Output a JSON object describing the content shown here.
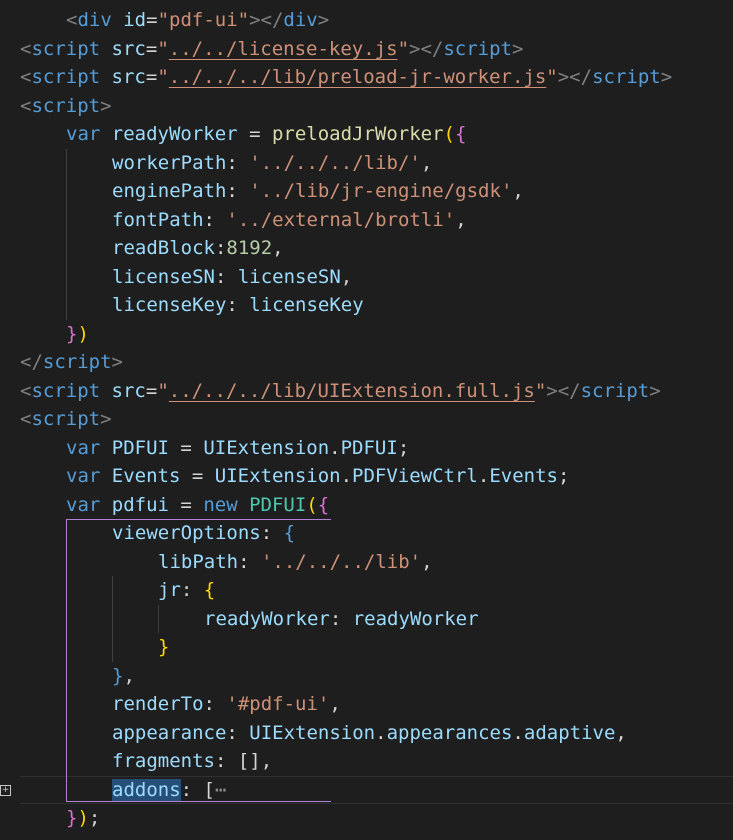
{
  "editor": {
    "lines": [
      {
        "indent": 1,
        "tokens": [
          [
            "t-tag",
            "<"
          ],
          [
            "t-name",
            "div"
          ],
          [
            "t-punc",
            " "
          ],
          [
            "t-attr",
            "id"
          ],
          [
            "t-punc",
            "="
          ],
          [
            "t-str",
            "\"pdf-ui\""
          ],
          [
            "t-tag",
            "></"
          ],
          [
            "t-name",
            "div"
          ],
          [
            "t-tag",
            ">"
          ]
        ]
      },
      {
        "indent": 0,
        "tokens": [
          [
            "t-tag",
            "<"
          ],
          [
            "t-name",
            "script"
          ],
          [
            "t-punc",
            " "
          ],
          [
            "t-attr",
            "src"
          ],
          [
            "t-punc",
            "="
          ],
          [
            "t-str",
            "\""
          ],
          [
            "t-str t-link",
            "../../license-key.js"
          ],
          [
            "t-str",
            "\""
          ],
          [
            "t-tag",
            "></"
          ],
          [
            "t-name",
            "script"
          ],
          [
            "t-tag",
            ">"
          ]
        ]
      },
      {
        "indent": 0,
        "tokens": [
          [
            "t-tag",
            "<"
          ],
          [
            "t-name",
            "script"
          ],
          [
            "t-punc",
            " "
          ],
          [
            "t-attr",
            "src"
          ],
          [
            "t-punc",
            "="
          ],
          [
            "t-str",
            "\""
          ],
          [
            "t-str t-link",
            "../../../lib/preload-jr-worker.js"
          ],
          [
            "t-str",
            "\""
          ],
          [
            "t-tag",
            "></"
          ],
          [
            "t-name",
            "script"
          ],
          [
            "t-tag",
            ">"
          ]
        ]
      },
      {
        "indent": 0,
        "tokens": [
          [
            "t-tag",
            "<"
          ],
          [
            "t-name",
            "script"
          ],
          [
            "t-tag",
            ">"
          ]
        ]
      },
      {
        "indent": 1,
        "tokens": [
          [
            "t-kw",
            "var"
          ],
          [
            "t-punc",
            " "
          ],
          [
            "t-var",
            "readyWorker"
          ],
          [
            "t-punc",
            " = "
          ],
          [
            "t-fn",
            "preloadJrWorker"
          ],
          [
            "t-b1",
            "("
          ],
          [
            "t-b2",
            "{"
          ]
        ]
      },
      {
        "indent": 2,
        "tokens": [
          [
            "t-var",
            "workerPath"
          ],
          [
            "t-punc",
            ": "
          ],
          [
            "t-str",
            "'../../../lib/'"
          ],
          [
            "t-punc",
            ","
          ]
        ]
      },
      {
        "indent": 2,
        "tokens": [
          [
            "t-var",
            "enginePath"
          ],
          [
            "t-punc",
            ": "
          ],
          [
            "t-str",
            "'../lib/jr-engine/gsdk'"
          ],
          [
            "t-punc",
            ","
          ]
        ]
      },
      {
        "indent": 2,
        "tokens": [
          [
            "t-var",
            "fontPath"
          ],
          [
            "t-punc",
            ": "
          ],
          [
            "t-str",
            "'../external/brotli'"
          ],
          [
            "t-punc",
            ","
          ]
        ]
      },
      {
        "indent": 2,
        "tokens": [
          [
            "t-var",
            "readBlock"
          ],
          [
            "t-punc",
            ":"
          ],
          [
            "t-num",
            "8192"
          ],
          [
            "t-punc",
            ","
          ]
        ]
      },
      {
        "indent": 2,
        "tokens": [
          [
            "t-var",
            "licenseSN"
          ],
          [
            "t-punc",
            ": "
          ],
          [
            "t-var",
            "licenseSN"
          ],
          [
            "t-punc",
            ","
          ]
        ]
      },
      {
        "indent": 2,
        "tokens": [
          [
            "t-var",
            "licenseKey"
          ],
          [
            "t-punc",
            ": "
          ],
          [
            "t-var",
            "licenseKey"
          ]
        ]
      },
      {
        "indent": 1,
        "tokens": [
          [
            "t-b2",
            "}"
          ],
          [
            "t-b1",
            ")"
          ]
        ]
      },
      {
        "indent": 0,
        "tokens": [
          [
            "t-tag",
            "</"
          ],
          [
            "t-name",
            "script"
          ],
          [
            "t-tag",
            ">"
          ]
        ]
      },
      {
        "indent": 0,
        "tokens": [
          [
            "t-tag",
            "<"
          ],
          [
            "t-name",
            "script"
          ],
          [
            "t-punc",
            " "
          ],
          [
            "t-attr",
            "src"
          ],
          [
            "t-punc",
            "="
          ],
          [
            "t-str",
            "\""
          ],
          [
            "t-str t-link",
            "../../../lib/UIExtension.full.js"
          ],
          [
            "t-str",
            "\""
          ],
          [
            "t-tag",
            "></"
          ],
          [
            "t-name",
            "script"
          ],
          [
            "t-tag",
            ">"
          ]
        ]
      },
      {
        "indent": 0,
        "tokens": [
          [
            "t-tag",
            "<"
          ],
          [
            "t-name",
            "script"
          ],
          [
            "t-tag",
            ">"
          ]
        ]
      },
      {
        "indent": 1,
        "tokens": [
          [
            "t-kw",
            "var"
          ],
          [
            "t-punc",
            " "
          ],
          [
            "t-var",
            "PDFUI"
          ],
          [
            "t-punc",
            " = "
          ],
          [
            "t-var",
            "UIExtension"
          ],
          [
            "t-punc",
            "."
          ],
          [
            "t-var",
            "PDFUI"
          ],
          [
            "t-punc",
            ";"
          ]
        ]
      },
      {
        "indent": 1,
        "tokens": [
          [
            "t-kw",
            "var"
          ],
          [
            "t-punc",
            " "
          ],
          [
            "t-var",
            "Events"
          ],
          [
            "t-punc",
            " = "
          ],
          [
            "t-var",
            "UIExtension"
          ],
          [
            "t-punc",
            "."
          ],
          [
            "t-var",
            "PDFViewCtrl"
          ],
          [
            "t-punc",
            "."
          ],
          [
            "t-var",
            "Events"
          ],
          [
            "t-punc",
            ";"
          ]
        ]
      },
      {
        "indent": 1,
        "tokens": [
          [
            "t-kw",
            "var"
          ],
          [
            "t-punc",
            " "
          ],
          [
            "t-var",
            "pdfui"
          ],
          [
            "t-punc",
            " = "
          ],
          [
            "t-kw",
            "new"
          ],
          [
            "t-punc",
            " "
          ],
          [
            "t-class",
            "PDFUI"
          ],
          [
            "t-b1",
            "("
          ],
          [
            "t-b2",
            "{"
          ]
        ]
      },
      {
        "indent": 2,
        "tokens": [
          [
            "t-var",
            "viewerOptions"
          ],
          [
            "t-punc",
            ": "
          ],
          [
            "t-name",
            "{"
          ]
        ]
      },
      {
        "indent": 3,
        "tokens": [
          [
            "t-var",
            "libPath"
          ],
          [
            "t-punc",
            ": "
          ],
          [
            "t-str",
            "'../../../lib'"
          ],
          [
            "t-punc",
            ","
          ]
        ]
      },
      {
        "indent": 3,
        "tokens": [
          [
            "t-var",
            "jr"
          ],
          [
            "t-punc",
            ": "
          ],
          [
            "t-b1",
            "{"
          ]
        ]
      },
      {
        "indent": 4,
        "tokens": [
          [
            "t-var",
            "readyWorker"
          ],
          [
            "t-punc",
            ": "
          ],
          [
            "t-var",
            "readyWorker"
          ]
        ]
      },
      {
        "indent": 3,
        "tokens": [
          [
            "t-b1",
            "}"
          ]
        ]
      },
      {
        "indent": 2,
        "tokens": [
          [
            "t-name",
            "}"
          ],
          [
            "t-punc",
            ","
          ]
        ]
      },
      {
        "indent": 2,
        "tokens": [
          [
            "t-var",
            "renderTo"
          ],
          [
            "t-punc",
            ": "
          ],
          [
            "t-str",
            "'#pdf-ui'"
          ],
          [
            "t-punc",
            ","
          ]
        ]
      },
      {
        "indent": 2,
        "tokens": [
          [
            "t-var",
            "appearance"
          ],
          [
            "t-punc",
            ": "
          ],
          [
            "t-var",
            "UIExtension"
          ],
          [
            "t-punc",
            "."
          ],
          [
            "t-var",
            "appearances"
          ],
          [
            "t-punc",
            "."
          ],
          [
            "t-var",
            "adaptive"
          ],
          [
            "t-punc",
            ","
          ]
        ]
      },
      {
        "indent": 2,
        "tokens": [
          [
            "t-var",
            "fragments"
          ],
          [
            "t-punc",
            ": "
          ],
          [
            "t-punc",
            "[],"
          ]
        ]
      },
      {
        "indent": 2,
        "tokens": [
          [
            "t-var t-hl",
            "addons"
          ],
          [
            "t-punc",
            ": "
          ],
          [
            "t-punc",
            "["
          ],
          [
            "t-fold",
            "⋯"
          ]
        ]
      },
      {
        "indent": 1,
        "tokens": [
          [
            "t-b2",
            "}"
          ],
          [
            "t-b1",
            ")"
          ],
          [
            "t-punc",
            ";"
          ]
        ]
      }
    ]
  }
}
